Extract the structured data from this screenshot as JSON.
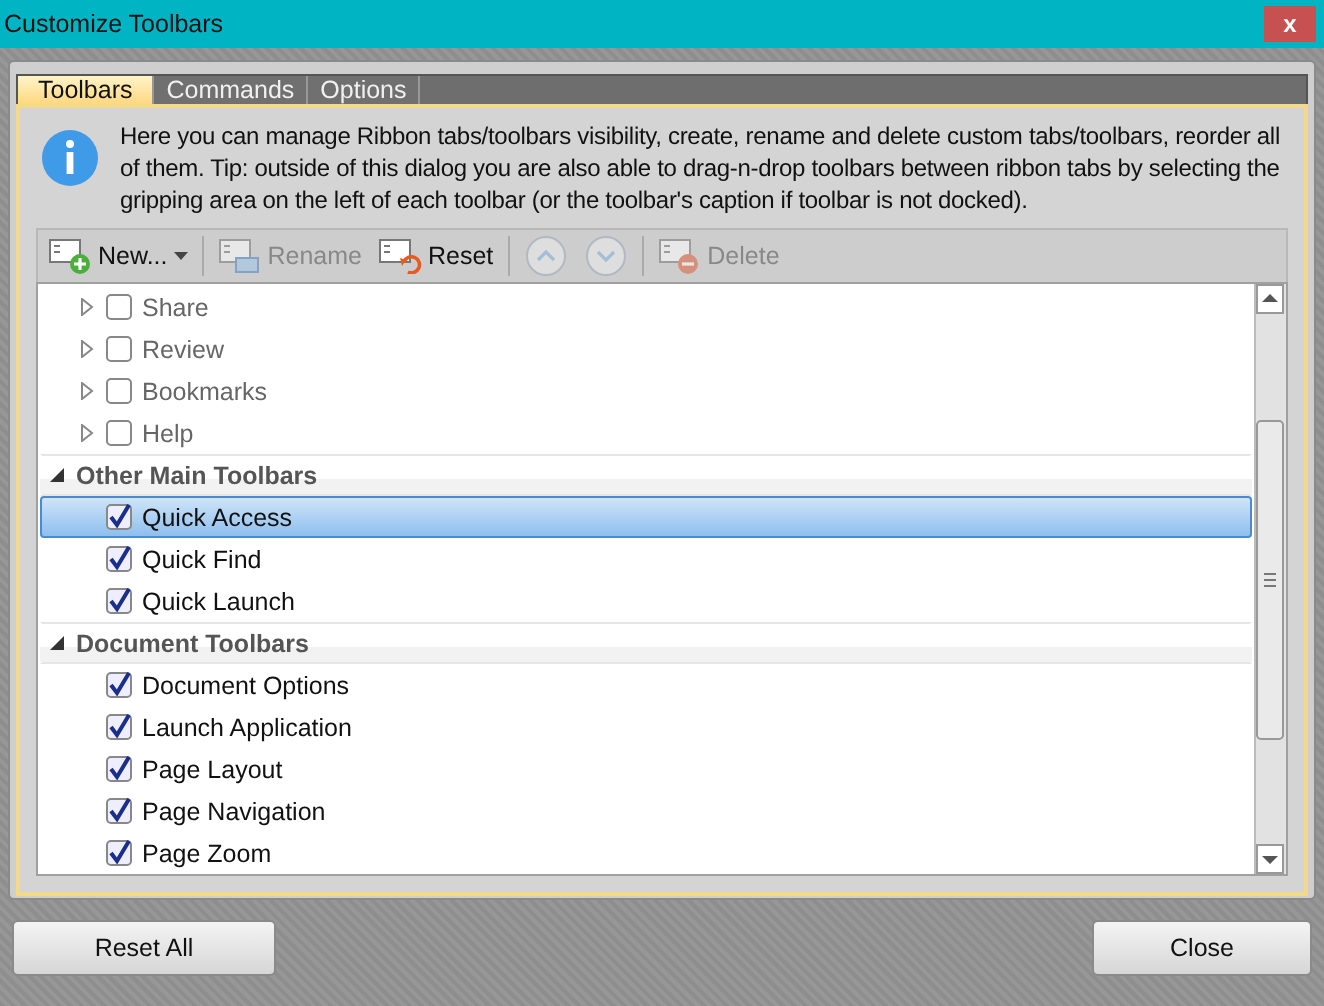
{
  "window": {
    "title": "Customize Toolbars",
    "close_glyph": "x"
  },
  "tabs": [
    {
      "label": "Toolbars",
      "selected": true
    },
    {
      "label": "Commands",
      "selected": false
    },
    {
      "label": "Options",
      "selected": false
    }
  ],
  "info": "Here you can manage Ribbon tabs/toolbars visibility, create, rename and delete custom tabs/toolbars, reorder all of them. Tip: outside of this dialog you are also able to drag-n-drop toolbars between ribbon tabs by selecting the gripping area on the left of each toolbar (or the toolbar's caption if toolbar is not docked).",
  "toolbar": [
    {
      "kind": "new",
      "label": "New...",
      "disabled": false
    },
    {
      "kind": "rename",
      "label": "Rename",
      "disabled": true
    },
    {
      "kind": "reset",
      "label": "Reset",
      "disabled": false
    },
    {
      "kind": "up",
      "disabled": true
    },
    {
      "kind": "down",
      "disabled": true
    },
    {
      "kind": "delete",
      "label": "Delete",
      "disabled": true
    }
  ],
  "tree": [
    {
      "kind": "item",
      "label": "Share",
      "checked": false,
      "expanded": false,
      "selected": false
    },
    {
      "kind": "item",
      "label": "Review",
      "checked": false,
      "expanded": false,
      "selected": false
    },
    {
      "kind": "item",
      "label": "Bookmarks",
      "checked": false,
      "expanded": false,
      "selected": false
    },
    {
      "kind": "item",
      "label": "Help",
      "checked": false,
      "expanded": false,
      "selected": false
    },
    {
      "kind": "group",
      "label": "Other Main Toolbars",
      "expanded": true,
      "children": [
        {
          "label": "Quick Access",
          "checked": true,
          "selected": true
        },
        {
          "label": "Quick Find",
          "checked": true,
          "selected": false
        },
        {
          "label": "Quick Launch",
          "checked": true,
          "selected": false
        }
      ]
    },
    {
      "kind": "group",
      "label": "Document Toolbars",
      "expanded": true,
      "children": [
        {
          "label": "Document Options",
          "checked": true,
          "selected": false
        },
        {
          "label": "Launch Application",
          "checked": true,
          "selected": false
        },
        {
          "label": "Page Layout",
          "checked": true,
          "selected": false
        },
        {
          "label": "Page Navigation",
          "checked": true,
          "selected": false
        },
        {
          "label": "Page Zoom",
          "checked": true,
          "selected": false
        }
      ]
    }
  ],
  "buttons": [
    {
      "label": "Reset All"
    },
    {
      "label": "Close"
    }
  ]
}
